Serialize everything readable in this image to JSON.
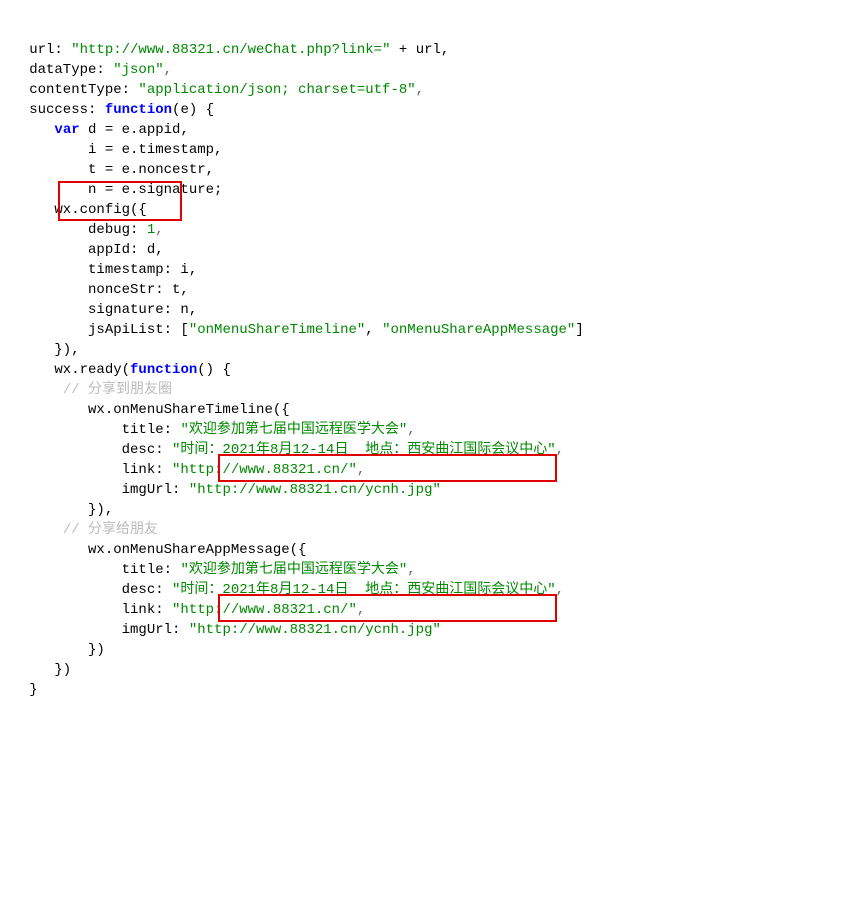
{
  "lines": {
    "0": {
      "a": "   url: ",
      "b": "\"http://www.88321.cn/weChat.php?link=\"",
      "c": " + url,"
    },
    "1": {
      "a": "   dataType: ",
      "b": "\"json\"",
      "c": ","
    },
    "2": {
      "a": "   contentType: ",
      "b": "\"application/json; charset=utf-8\"",
      "c": ","
    },
    "3": {
      "a": "   success: ",
      "b": "function",
      "c": "(e) {"
    },
    "4": {
      "pad": "      ",
      "a": "var",
      "b": " d = e.appid,"
    },
    "5": {
      "a": "          i = e.timestamp,"
    },
    "6": {
      "a": "          t = e.noncestr,"
    },
    "7": {
      "a": "          n = e.signature;"
    },
    "8": {
      "a": "      wx.config({"
    },
    "9": {
      "a": "          debug: ",
      "b": "1",
      "c": ","
    },
    "10": {
      "a": "          appId: d,"
    },
    "11": {
      "a": "          timestamp: i,"
    },
    "12": {
      "a": "          nonceStr: t,"
    },
    "13": {
      "a": "          signature: n,"
    },
    "14": {
      "a": "          jsApiList: [",
      "b": "\"onMenuShareTimeline\"",
      "c": ", ",
      "d": "\"onMenuShareAppMessage\"",
      "e": "]"
    },
    "15": {
      "a": "      }),"
    },
    "16": {
      "a": "      wx.ready(",
      "b": "function",
      "c": "() {"
    },
    "17": {
      "pad": "       ",
      "a": "// 分享到朋友圈"
    },
    "18": {
      "a": "          wx.onMenuShareTimeline({"
    },
    "19": {
      "a": "              title: ",
      "b": "\"欢迎参加第七届中国远程医学大会\"",
      "c": ","
    },
    "20": {
      "a": "              desc: ",
      "b": "\"时间：2021年8月12-14日  地点：西安曲江国际会议中心\"",
      "c": ","
    },
    "21": {
      "a": "              link: ",
      "b": "\"http://www.88321.cn/\"",
      "c": ","
    },
    "22": {
      "a": "              imgUrl: ",
      "b": "\"http://www.88321.cn/ycnh.jpg\""
    },
    "23": {
      "a": "          }),"
    },
    "24": {
      "pad": "       ",
      "a": "// 分享给朋友"
    },
    "25": {
      "a": "          wx.onMenuShareAppMessage({"
    },
    "26": {
      "a": "              title: ",
      "b": "\"欢迎参加第七届中国远程医学大会\"",
      "c": ","
    },
    "27": {
      "a": "              desc: ",
      "b": "\"时间：2021年8月12-14日  地点：西安曲江国际会议中心\"",
      "c": ","
    },
    "28": {
      "a": "              link: ",
      "b": "\"http://www.88321.cn/\"",
      "c": ","
    },
    "29": {
      "a": "              imgUrl: ",
      "b": "\"http://www.88321.cn/ycnh.jpg\""
    },
    "30": {
      "a": "          })"
    },
    "31": {
      "a": "      })"
    },
    "32": {
      "a": "   }"
    }
  },
  "highlight_boxes": [
    "debug: 1,",
    "\"http://www.88321.cn/ycnh.jpg\"",
    "\"http://www.88321.cn/ycnh.jpg\""
  ],
  "colors": {
    "keyword": "#0000ff",
    "string": "#008800",
    "comment": "#bbbbbb",
    "highlight_border": "#e00000"
  }
}
